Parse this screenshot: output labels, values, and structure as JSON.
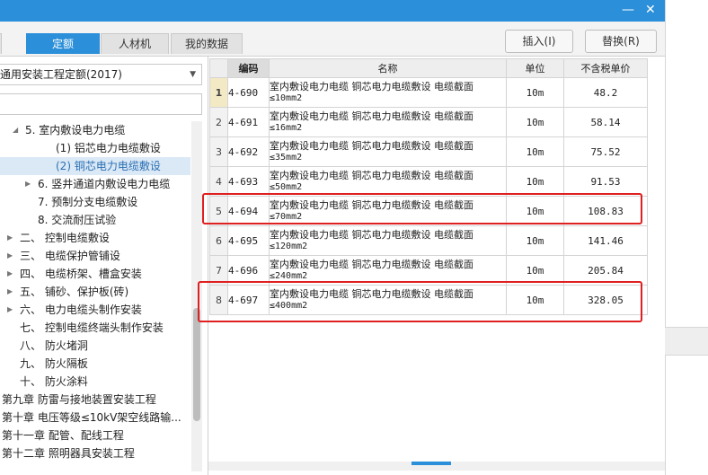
{
  "window": {
    "min_glyph": "—",
    "close_glyph": "✕"
  },
  "tabs": [
    {
      "label": "定额",
      "active": true
    },
    {
      "label": "人材机",
      "active": false
    },
    {
      "label": "我的数据",
      "active": false
    }
  ],
  "toolbar": {
    "insert_label": "插入(I)",
    "replace_label": "替换(R)"
  },
  "library_select": {
    "value": "通用安装工程定额(2017)"
  },
  "tree": [
    {
      "label": "5. 室内敷设电力电缆",
      "indent": 28,
      "toggle": "expanded"
    },
    {
      "label": "(1) 铝芯电力电缆敷设",
      "indent": 62
    },
    {
      "label": "(2) 铜芯电力电缆敷设",
      "indent": 62,
      "selected": true
    },
    {
      "label": "6. 竖井通道内敷设电力电缆",
      "indent": 42,
      "toggle": "collapsed"
    },
    {
      "label": "7. 预制分支电缆敷设",
      "indent": 42
    },
    {
      "label": "8. 交流耐压试验",
      "indent": 42
    },
    {
      "label": "二、 控制电缆敷设",
      "indent": 22,
      "toggle": "collapsed"
    },
    {
      "label": "三、 电缆保护管铺设",
      "indent": 22,
      "toggle": "collapsed"
    },
    {
      "label": "四、 电缆桥架、槽盒安装",
      "indent": 22,
      "toggle": "collapsed"
    },
    {
      "label": "五、 铺砂、保护板(砖)",
      "indent": 22,
      "toggle": "collapsed"
    },
    {
      "label": "六、 电力电缆头制作安装",
      "indent": 22,
      "toggle": "collapsed"
    },
    {
      "label": "七、 控制电缆终端头制作安装",
      "indent": 22
    },
    {
      "label": "八、 防火堵洞",
      "indent": 22
    },
    {
      "label": "九、 防火隔板",
      "indent": 22
    },
    {
      "label": "十、 防火涂料",
      "indent": 22
    },
    {
      "label": "第九章 防雷与接地装置安装工程",
      "indent": 2
    },
    {
      "label": "第十章 电压等级≤10kV架空线路输...",
      "indent": 2
    },
    {
      "label": "第十一章 配管、配线工程",
      "indent": 2
    },
    {
      "label": "第十二章 照明器具安装工程",
      "indent": 2
    }
  ],
  "table": {
    "columns": [
      "编码",
      "名称",
      "单位",
      "不含税单价"
    ],
    "name_prefix": "室内敷设电力电缆 铜芯电力电缆敷设 电缆截面",
    "rows": [
      {
        "no": "1",
        "code": "4-690",
        "spec": "≤10mm2",
        "unit": "10m",
        "price": "48.2"
      },
      {
        "no": "2",
        "code": "4-691",
        "spec": "≤16mm2",
        "unit": "10m",
        "price": "58.14"
      },
      {
        "no": "3",
        "code": "4-692",
        "spec": "≤35mm2",
        "unit": "10m",
        "price": "75.52"
      },
      {
        "no": "4",
        "code": "4-693",
        "spec": "≤50mm2",
        "unit": "10m",
        "price": "91.53"
      },
      {
        "no": "5",
        "code": "4-694",
        "spec": "≤70mm2",
        "unit": "10m",
        "price": "108.83"
      },
      {
        "no": "6",
        "code": "4-695",
        "spec": "≤120mm2",
        "unit": "10m",
        "price": "141.46"
      },
      {
        "no": "7",
        "code": "4-696",
        "spec": "≤240mm2",
        "unit": "10m",
        "price": "205.84"
      },
      {
        "no": "8",
        "code": "4-697",
        "spec": "≤400mm2",
        "unit": "10m",
        "price": "328.05"
      }
    ]
  },
  "colors": {
    "accent": "#2b8fd9",
    "highlight": "#e02020",
    "selected_bg": "#dbe9f6"
  }
}
